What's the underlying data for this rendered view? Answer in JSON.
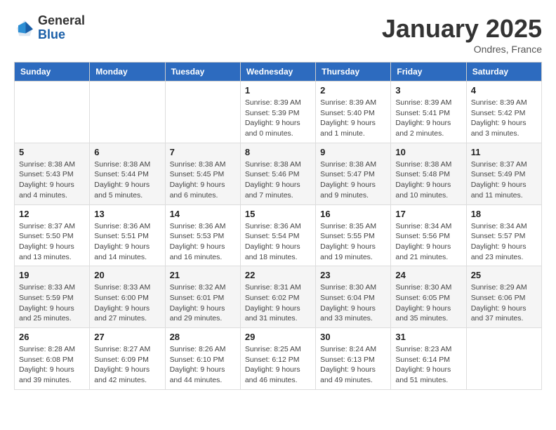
{
  "header": {
    "logo_general": "General",
    "logo_blue": "Blue",
    "month_title": "January 2025",
    "subtitle": "Ondres, France"
  },
  "weekdays": [
    "Sunday",
    "Monday",
    "Tuesday",
    "Wednesday",
    "Thursday",
    "Friday",
    "Saturday"
  ],
  "weeks": [
    [
      {
        "day": "",
        "info": ""
      },
      {
        "day": "",
        "info": ""
      },
      {
        "day": "",
        "info": ""
      },
      {
        "day": "1",
        "info": "Sunrise: 8:39 AM\nSunset: 5:39 PM\nDaylight: 9 hours\nand 0 minutes."
      },
      {
        "day": "2",
        "info": "Sunrise: 8:39 AM\nSunset: 5:40 PM\nDaylight: 9 hours\nand 1 minute."
      },
      {
        "day": "3",
        "info": "Sunrise: 8:39 AM\nSunset: 5:41 PM\nDaylight: 9 hours\nand 2 minutes."
      },
      {
        "day": "4",
        "info": "Sunrise: 8:39 AM\nSunset: 5:42 PM\nDaylight: 9 hours\nand 3 minutes."
      }
    ],
    [
      {
        "day": "5",
        "info": "Sunrise: 8:38 AM\nSunset: 5:43 PM\nDaylight: 9 hours\nand 4 minutes."
      },
      {
        "day": "6",
        "info": "Sunrise: 8:38 AM\nSunset: 5:44 PM\nDaylight: 9 hours\nand 5 minutes."
      },
      {
        "day": "7",
        "info": "Sunrise: 8:38 AM\nSunset: 5:45 PM\nDaylight: 9 hours\nand 6 minutes."
      },
      {
        "day": "8",
        "info": "Sunrise: 8:38 AM\nSunset: 5:46 PM\nDaylight: 9 hours\nand 7 minutes."
      },
      {
        "day": "9",
        "info": "Sunrise: 8:38 AM\nSunset: 5:47 PM\nDaylight: 9 hours\nand 9 minutes."
      },
      {
        "day": "10",
        "info": "Sunrise: 8:38 AM\nSunset: 5:48 PM\nDaylight: 9 hours\nand 10 minutes."
      },
      {
        "day": "11",
        "info": "Sunrise: 8:37 AM\nSunset: 5:49 PM\nDaylight: 9 hours\nand 11 minutes."
      }
    ],
    [
      {
        "day": "12",
        "info": "Sunrise: 8:37 AM\nSunset: 5:50 PM\nDaylight: 9 hours\nand 13 minutes."
      },
      {
        "day": "13",
        "info": "Sunrise: 8:36 AM\nSunset: 5:51 PM\nDaylight: 9 hours\nand 14 minutes."
      },
      {
        "day": "14",
        "info": "Sunrise: 8:36 AM\nSunset: 5:53 PM\nDaylight: 9 hours\nand 16 minutes."
      },
      {
        "day": "15",
        "info": "Sunrise: 8:36 AM\nSunset: 5:54 PM\nDaylight: 9 hours\nand 18 minutes."
      },
      {
        "day": "16",
        "info": "Sunrise: 8:35 AM\nSunset: 5:55 PM\nDaylight: 9 hours\nand 19 minutes."
      },
      {
        "day": "17",
        "info": "Sunrise: 8:34 AM\nSunset: 5:56 PM\nDaylight: 9 hours\nand 21 minutes."
      },
      {
        "day": "18",
        "info": "Sunrise: 8:34 AM\nSunset: 5:57 PM\nDaylight: 9 hours\nand 23 minutes."
      }
    ],
    [
      {
        "day": "19",
        "info": "Sunrise: 8:33 AM\nSunset: 5:59 PM\nDaylight: 9 hours\nand 25 minutes."
      },
      {
        "day": "20",
        "info": "Sunrise: 8:33 AM\nSunset: 6:00 PM\nDaylight: 9 hours\nand 27 minutes."
      },
      {
        "day": "21",
        "info": "Sunrise: 8:32 AM\nSunset: 6:01 PM\nDaylight: 9 hours\nand 29 minutes."
      },
      {
        "day": "22",
        "info": "Sunrise: 8:31 AM\nSunset: 6:02 PM\nDaylight: 9 hours\nand 31 minutes."
      },
      {
        "day": "23",
        "info": "Sunrise: 8:30 AM\nSunset: 6:04 PM\nDaylight: 9 hours\nand 33 minutes."
      },
      {
        "day": "24",
        "info": "Sunrise: 8:30 AM\nSunset: 6:05 PM\nDaylight: 9 hours\nand 35 minutes."
      },
      {
        "day": "25",
        "info": "Sunrise: 8:29 AM\nSunset: 6:06 PM\nDaylight: 9 hours\nand 37 minutes."
      }
    ],
    [
      {
        "day": "26",
        "info": "Sunrise: 8:28 AM\nSunset: 6:08 PM\nDaylight: 9 hours\nand 39 minutes."
      },
      {
        "day": "27",
        "info": "Sunrise: 8:27 AM\nSunset: 6:09 PM\nDaylight: 9 hours\nand 42 minutes."
      },
      {
        "day": "28",
        "info": "Sunrise: 8:26 AM\nSunset: 6:10 PM\nDaylight: 9 hours\nand 44 minutes."
      },
      {
        "day": "29",
        "info": "Sunrise: 8:25 AM\nSunset: 6:12 PM\nDaylight: 9 hours\nand 46 minutes."
      },
      {
        "day": "30",
        "info": "Sunrise: 8:24 AM\nSunset: 6:13 PM\nDaylight: 9 hours\nand 49 minutes."
      },
      {
        "day": "31",
        "info": "Sunrise: 8:23 AM\nSunset: 6:14 PM\nDaylight: 9 hours\nand 51 minutes."
      },
      {
        "day": "",
        "info": ""
      }
    ]
  ]
}
